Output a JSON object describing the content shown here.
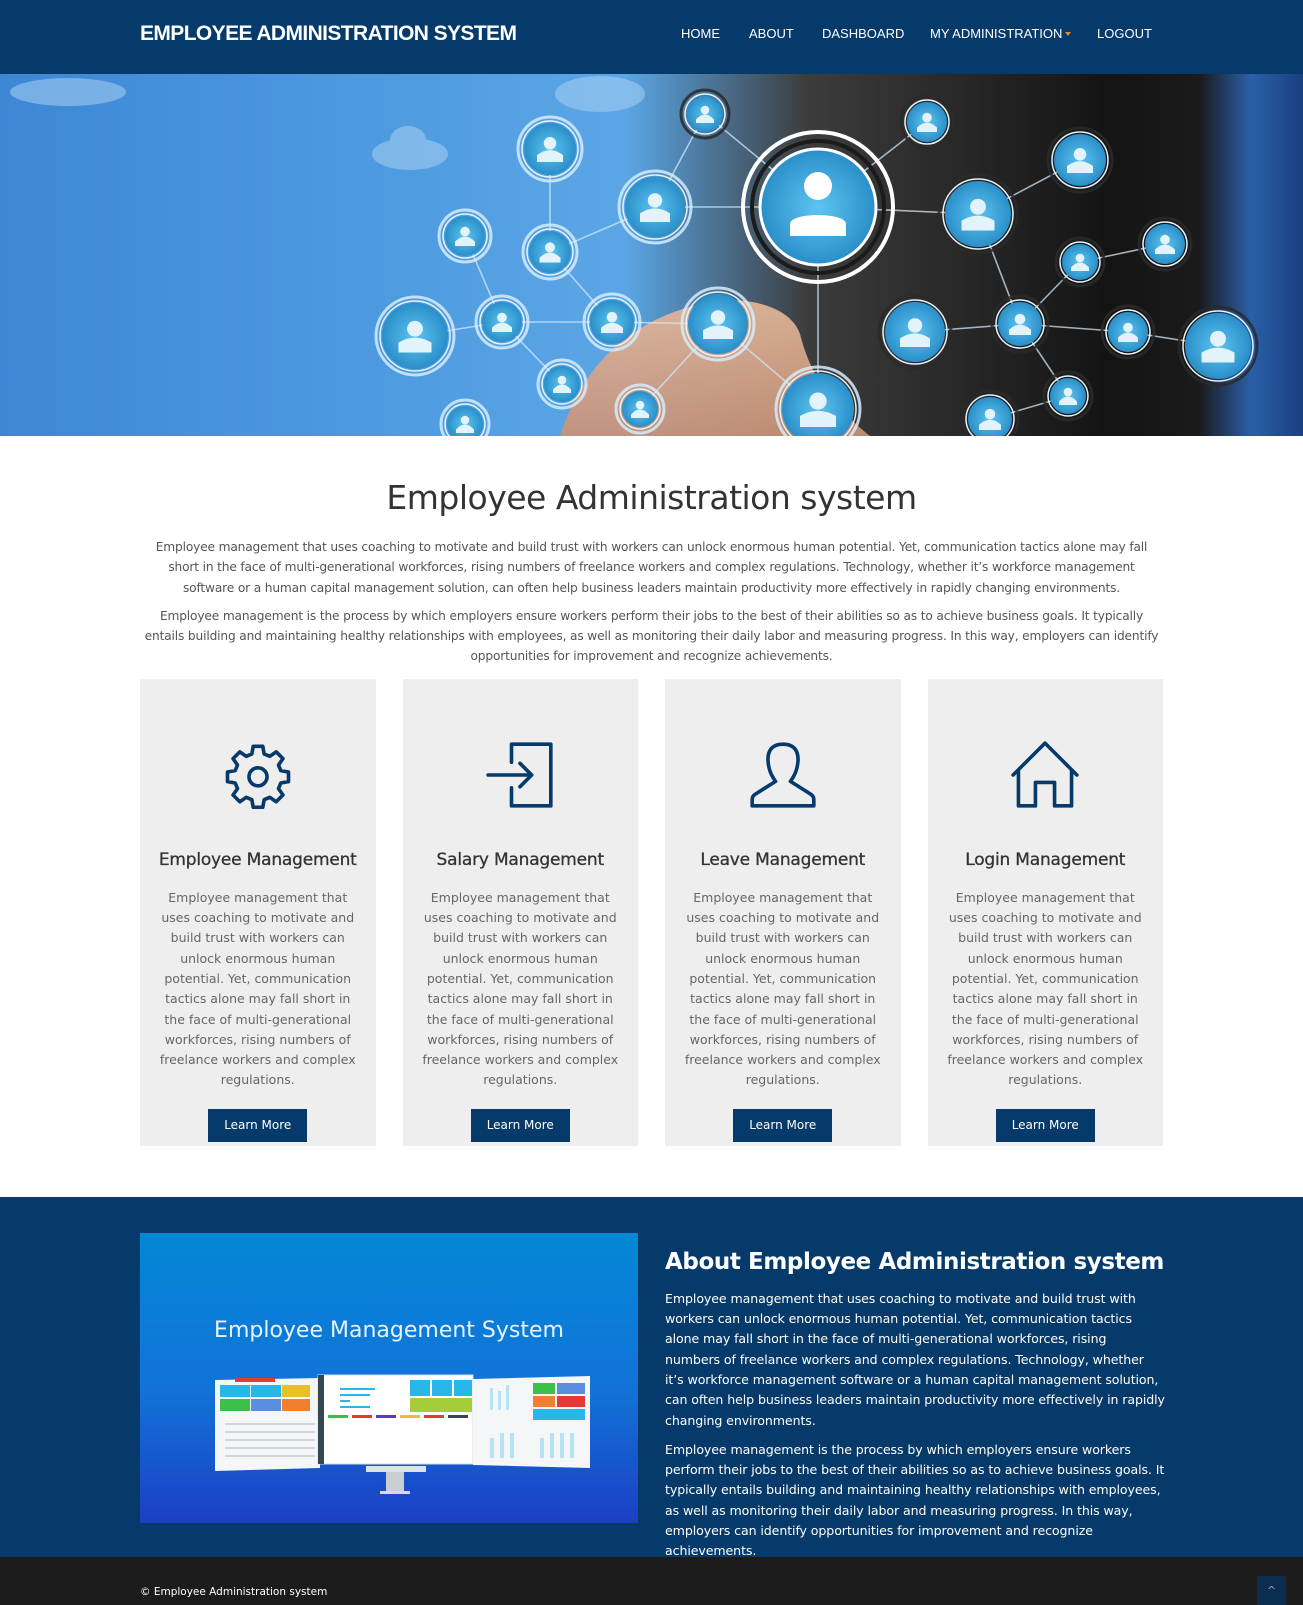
{
  "navbar": {
    "brand": "EMPLOYEE ADMINISTRATION SYSTEM",
    "items": [
      {
        "label": "HOME",
        "icon": null
      },
      {
        "label": "ABOUT",
        "icon": null
      },
      {
        "label": "DASHBOARD",
        "icon": null
      },
      {
        "label": "MY ADMINISTRATION",
        "icon": "caret-down-icon"
      },
      {
        "label": "LOGOUT",
        "icon": null
      }
    ]
  },
  "hero": {
    "image": "network-of-people-icons-touched-by-finger"
  },
  "intro": {
    "title": "Employee Administration system",
    "paragraphs": [
      "Employee management that uses coaching to motivate and build trust with workers can unlock enormous human potential. Yet, communication tactics alone may fall short in the face of multi-generational workforces, rising numbers of freelance workers and complex regulations. Technology, whether it’s workforce management software or a human capital management solution, can often help business leaders maintain productivity more effectively in rapidly changing environments.",
      "Employee management is the process by which employers ensure workers perform their jobs to the best of their abilities so as to achieve business goals. It typically entails building and maintaining healthy relationships with employees, as well as monitoring their daily labor and measuring progress. In this way, employers can identify opportunities for improvement and recognize achievements."
    ]
  },
  "cards": [
    {
      "icon": "gear-icon",
      "title": "Employee Management",
      "text": "Employee management that uses coaching to motivate and build trust with workers can unlock enormous human potential. Yet, communication tactics alone may fall short in the face of multi-generational workforces, rising numbers of freelance workers and complex regulations.",
      "button": "Learn More"
    },
    {
      "icon": "sign-in-icon",
      "title": "Salary Management",
      "text": "Employee management that uses coaching to motivate and build trust with workers can unlock enormous human potential. Yet, communication tactics alone may fall short in the face of multi-generational workforces, rising numbers of freelance workers and complex regulations.",
      "button": "Learn More"
    },
    {
      "icon": "user-icon",
      "title": "Leave Management",
      "text": "Employee management that uses coaching to motivate and build trust with workers can unlock enormous human potential. Yet, communication tactics alone may fall short in the face of multi-generational workforces, rising numbers of freelance workers and complex regulations.",
      "button": "Learn More"
    },
    {
      "icon": "home-icon",
      "title": "Login Management",
      "text": "Employee management that uses coaching to motivate and build trust with workers can unlock enormous human potential. Yet, communication tactics alone may fall short in the face of multi-generational workforces, rising numbers of freelance workers and complex regulations.",
      "button": "Learn More"
    }
  ],
  "about": {
    "image_title": "Employee Management System",
    "title": "About Employee Administration system",
    "paragraphs": [
      "Employee management that uses coaching to motivate and build trust with workers can unlock enormous human potential. Yet, communication tactics alone may fall short in the face of multi-generational workforces, rising numbers of freelance workers and complex regulations. Technology, whether it’s workforce management software or a human capital management solution, can often help business leaders maintain productivity more effectively in rapidly changing environments.",
      "Employee management is the process by which employers ensure workers perform their jobs to the best of their abilities so as to achieve business goals. It typically entails building and maintaining healthy relationships with employees, as well as monitoring their daily labor and measuring progress. In this way, employers can identify opportunities for improvement and recognize achievements."
    ]
  },
  "footer": {
    "copyright": "© Employee Administration system",
    "to_top_icon": "chevron-up-icon",
    "to_top_glyph": "^"
  },
  "colors": {
    "primary": "#053a6b",
    "card_bg": "#eeeeee",
    "footer_bg": "#1c1c1c",
    "caret": "#d98e2c"
  }
}
